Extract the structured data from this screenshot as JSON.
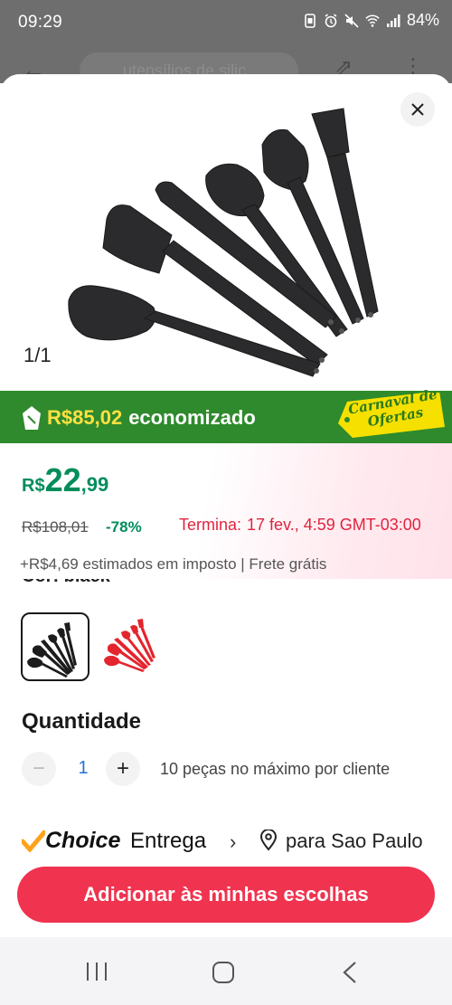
{
  "status_bar": {
    "time": "09:29",
    "battery": "84%",
    "icons": [
      "samsung-icon",
      "alarm-icon",
      "mute-icon",
      "wifi-icon",
      "signal-icon"
    ]
  },
  "background_page": {
    "search_placeholder": "utensílios de silic",
    "icons": [
      "back-arrow-icon",
      "share-icon",
      "more-icon"
    ]
  },
  "gallery": {
    "counter": "1/1",
    "image": "black silicone utensil set"
  },
  "banner": {
    "amount": "R$85,02",
    "word": "economizado",
    "promo_tag": "Carnaval de Ofertas",
    "colors": {
      "banner_green": "#2e8a2c",
      "amount_yellow": "#ffe042"
    }
  },
  "price": {
    "currency": "R$",
    "integer": "22",
    "cents": ",99",
    "original": "R$108,01",
    "discount": "-78%",
    "ends_label": "Termina:",
    "ends_value": "17 fev., 4:59 GMT-03:00",
    "tax_line": "+R$4,69 estimados em imposto | Frete grátis",
    "colors": {
      "price_green": "#008d5b",
      "ends_red": "#e0243f"
    }
  },
  "variant": {
    "title": "Cor: black",
    "options": [
      "black",
      "red"
    ]
  },
  "quantity": {
    "title": "Quantidade",
    "value": "1",
    "minus": "−",
    "plus": "+",
    "limit": "10 peças no máximo por cliente"
  },
  "delivery": {
    "brand": "Choice",
    "label": "Entrega",
    "chevron": "›",
    "destination": "para Sao Paulo"
  },
  "cta": {
    "label": "Adicionar às minhas escolhas",
    "color": "#f0334f"
  },
  "nav_bar": {
    "icons": [
      "recent-apps-icon",
      "home-icon",
      "back-icon"
    ]
  }
}
